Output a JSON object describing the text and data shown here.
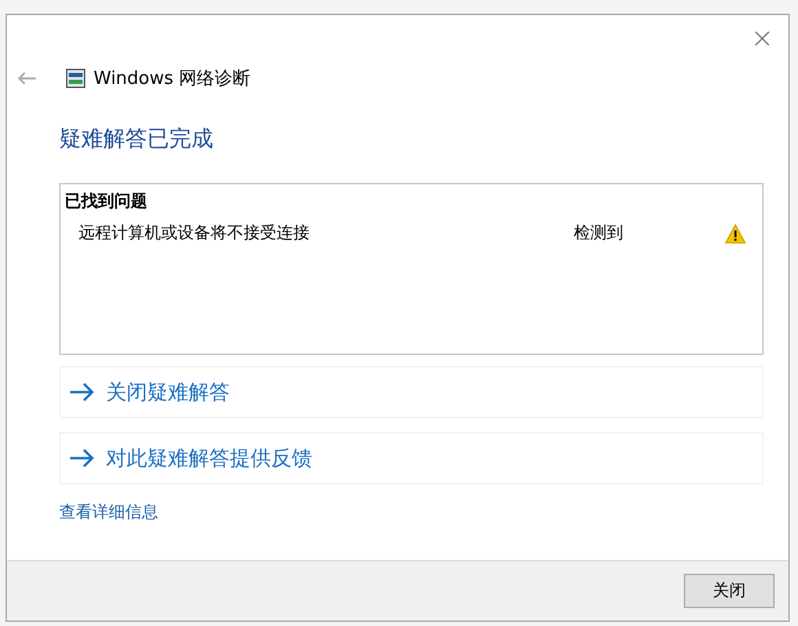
{
  "window": {
    "title": "Windows 网络诊断"
  },
  "heading": "疑难解答已完成",
  "problems": {
    "title": "已找到问题",
    "rows": [
      {
        "name": "远程计算机或设备将不接受连接",
        "status": "检测到",
        "kind": "warning"
      }
    ]
  },
  "links": [
    "关闭疑难解答",
    "对此疑难解答提供反馈"
  ],
  "details_link": "查看详细信息",
  "buttons": [
    "关闭"
  ]
}
